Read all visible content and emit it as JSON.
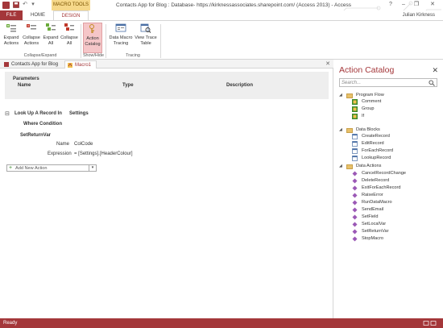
{
  "window": {
    "title": "Contacts App for Blog : Database- https://kirknessassociates.sharepoint.com/ (Access 2013) - Access",
    "contextual_tab": "MACRO TOOLS",
    "user": "Julian Kirkness",
    "help_glyph": "?",
    "minimize_glyph": "–",
    "restore_glyph": "❐",
    "close_glyph": "✕",
    "qat_save_glyph": "💾",
    "qat_undo_glyph": "↶",
    "qat_more_glyph": "▾"
  },
  "ribbon_tabs": [
    "FILE",
    "HOME",
    "DESIGN"
  ],
  "ribbon": {
    "groups": [
      {
        "label": "Collapse/Expand",
        "buttons": [
          "Expand\nActions",
          "Collapse\nActions",
          "Expand\nAll",
          "Collapse\nAll"
        ]
      },
      {
        "label": "Show/Hide",
        "buttons": [
          "Action\nCatalog"
        ]
      },
      {
        "label": "Tracing",
        "buttons": [
          "Data Macro\nTracing",
          "View Trace\nTable"
        ]
      }
    ],
    "selected_button": "Action Catalog"
  },
  "doc_tabs": [
    "Contacts App for Blog",
    "Macro1"
  ],
  "active_doc_tab": "Macro1",
  "doc_close_glyph": "✕",
  "designer": {
    "parameters": {
      "title": "Parameters",
      "col_name": "Name",
      "col_type": "Type",
      "col_description": "Description"
    },
    "collapse_glyph": "⊟",
    "lookup_label": "Look Up A Record In",
    "lookup_value": "Settings",
    "where_condition": "Where Condition",
    "set_return_var": "SetReturnVar",
    "name_label": "Name",
    "name_value": "ColCode",
    "expression_label": "Expression",
    "expression_value": "= [Settings].[HeaderColour]",
    "add_new_action": "Add New Action",
    "add_glyph": "+",
    "dropdown_glyph": "▾"
  },
  "catalog": {
    "title": "Action Catalog",
    "close_glyph": "✕",
    "search_placeholder": "Search...",
    "sections": [
      {
        "label": "Program Flow",
        "items": [
          "Comment",
          "Group",
          "If"
        ]
      },
      {
        "label": "Data Blocks",
        "items": [
          "CreateRecord",
          "EditRecord",
          "ForEachRecord",
          "LookupRecord"
        ]
      },
      {
        "label": "Data Actions",
        "items": [
          "CancelRecordChange",
          "DeleteRecord",
          "ExitForEachRecord",
          "RaiseError",
          "RunDataMacro",
          "SendEmail",
          "SetField",
          "SetLocalVar",
          "SetReturnVar",
          "StopMacro"
        ]
      }
    ],
    "expanded_glyph": "◢"
  },
  "status": {
    "text": "Ready"
  },
  "colors": {
    "accent": "#a4373a",
    "macro_tools": "#f6d88a",
    "selected": "#f5c6c8"
  }
}
